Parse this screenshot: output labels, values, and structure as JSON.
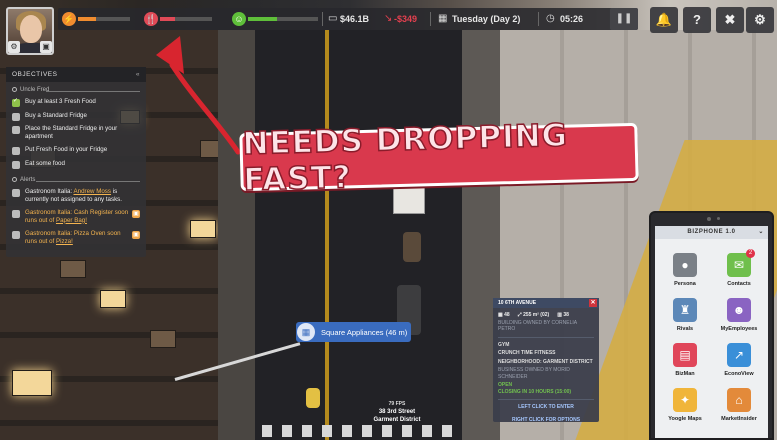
{
  "topbar": {
    "money": "$46.1B",
    "delta": "-$349",
    "date": "Tuesday (Day 2)",
    "time": "05:26",
    "colors": {
      "energy": "#f08c2f",
      "hunger": "#e04a57",
      "happiness": "#5fbf3a",
      "money_green": "#e8e8e8",
      "delta_red": "#e4404f"
    },
    "needs": {
      "energy": 0.35,
      "hunger": 0.28,
      "happiness": 0.42
    }
  },
  "objectives": {
    "title": "OBJECTIVES",
    "section1": "Uncle Fred",
    "tasks": [
      {
        "text": "Buy at least 3 Fresh Food",
        "done": true
      },
      {
        "text": "Buy a Standard Fridge",
        "done": false
      },
      {
        "text": "Place the Standard Fridge in your apartment",
        "done": false
      },
      {
        "text": "Put Fresh Food in your Fridge",
        "done": false
      },
      {
        "text": "Eat some food",
        "done": false
      }
    ],
    "section2": "Alerts",
    "alerts": [
      {
        "prefix": "Gastronom Italia: ",
        "link": "Andrew Moss",
        "suffix": " is currently not assigned to any tasks."
      },
      {
        "prefix": "Gastronom Italia: Cash Register soon runs out of ",
        "link": "Paper Bag!",
        "suffix": ""
      },
      {
        "prefix": "Gastronom Italia: Pizza Oven soon runs out of ",
        "link": "Pizza!",
        "suffix": ""
      }
    ]
  },
  "headline": "NEEDS DROPPING FAST?",
  "location_tag": "Square Appliances (46 m)",
  "hud_bottom": {
    "fps": "79 FPS",
    "address": "38 3rd Street",
    "district": "Garment District"
  },
  "building_card": {
    "title": "10 6TH AVENUE",
    "stats": [
      "48",
      "255 m² (02)",
      "38"
    ],
    "owner": "BUILDING OWNED BY CORNELIA PETRO",
    "type": "GYM",
    "name": "CRUNCH TIME FITNESS",
    "neighborhood": "NEIGHBORHOOD: GARMENT DISTRICT",
    "business_owner": "BUSINESS OWNED BY MORID SCHNEIDER",
    "status": "OPEN",
    "closing": "CLOSING IN 10 HOURS (15:00)",
    "left_cta": "LEFT CLICK TO ENTER",
    "right_cta": "RIGHT CLICK FOR OPTIONS"
  },
  "phone": {
    "title": "BIZPHONE 1.0",
    "chevron": "⌄",
    "apps": [
      {
        "label": "Persona",
        "icon": "person-icon",
        "color": "#7a8087"
      },
      {
        "label": "Contacts",
        "icon": "chat-icon",
        "color": "#6fbf4c",
        "badge": "2"
      },
      {
        "label": "Rivals",
        "icon": "chess-icon",
        "color": "#5c88b8"
      },
      {
        "label": "MyEmployees",
        "icon": "people-icon",
        "color": "#8a64c2"
      },
      {
        "label": "BizMan",
        "icon": "briefcase-icon",
        "color": "#e0465a"
      },
      {
        "label": "EconoView",
        "icon": "trend-icon",
        "color": "#3a8fd8"
      },
      {
        "label": "Yoogle Maps",
        "icon": "map-icon",
        "color": "#f0b53a"
      },
      {
        "label": "MarketInsider",
        "icon": "house-icon",
        "color": "#e38a3a"
      }
    ]
  }
}
